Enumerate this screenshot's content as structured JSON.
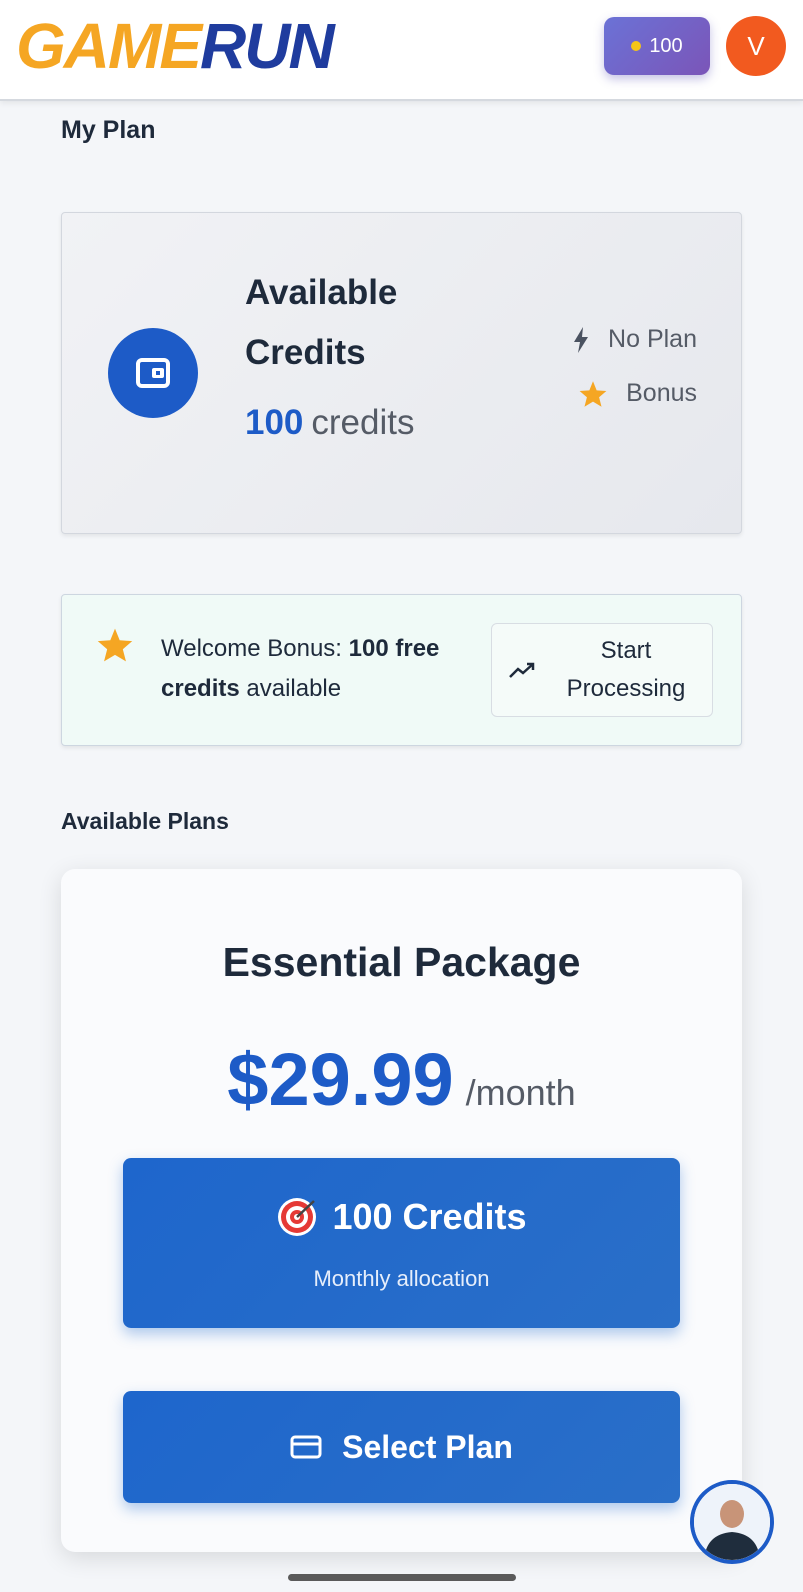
{
  "header": {
    "logo_text": "GAMERUN",
    "credit_balance": "100",
    "avatar_initial": "V"
  },
  "my_plan": {
    "title": "My Plan",
    "credits_card": {
      "title": "Available Credits",
      "amount": "100",
      "unit": "credits",
      "plan_status": "No Plan",
      "bonus_label": "Bonus"
    },
    "bonus_banner": {
      "prefix": "Welcome Bonus:",
      "highlight": "100 free credits",
      "suffix": "available",
      "button_label": "Start Processing"
    }
  },
  "available_plans": {
    "title": "Available Plans",
    "plans": [
      {
        "name": "Essential Package",
        "price": "$29.99",
        "period": "/month",
        "credits_label": "100 Credits",
        "credits_sub": "Monthly allocation",
        "select_label": "Select Plan"
      }
    ]
  },
  "colors": {
    "primary": "#1d5bc7",
    "logo_orange": "#f5a623",
    "logo_blue": "#1f3c9e",
    "avatar_bg": "#f25a1f",
    "pill_gradient_start": "#6b72d6",
    "pill_gradient_end": "#7b55b8",
    "star": "#f5a623"
  }
}
